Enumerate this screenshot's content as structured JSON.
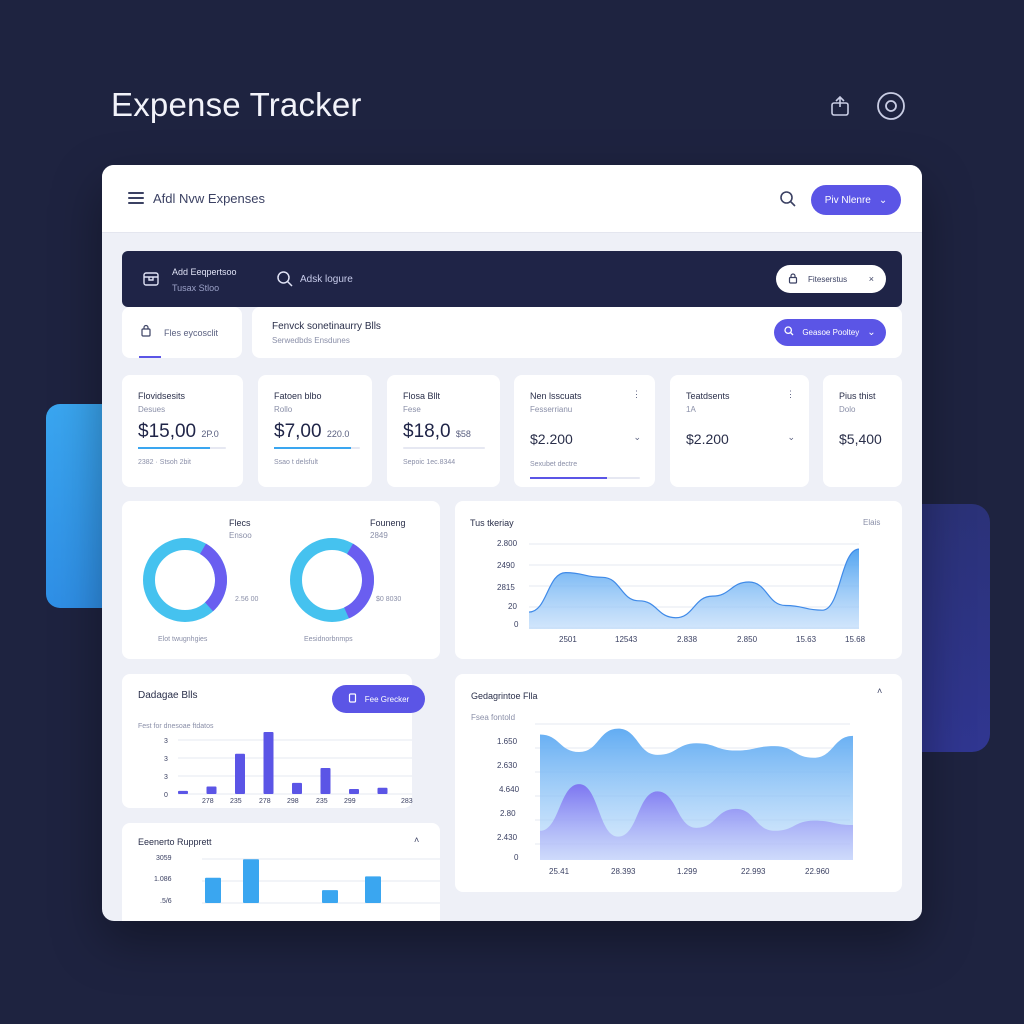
{
  "page": {
    "title": "Expense Tracker"
  },
  "top_icons": [
    "share-icon",
    "record-icon"
  ],
  "topbar": {
    "title": "Afdl Nvw Expenses",
    "action_label": "Piv Nlenre"
  },
  "darkbar": {
    "line1": "Add Eeqpertsoo",
    "line2": "Tusax Stloo",
    "search_label": "Adsk logure",
    "chip_label": "Fiteserstus",
    "chip_close": "×"
  },
  "subbar": {
    "tab_label": "Fles eycosclit",
    "title": "Fenvck sonetinaurry Blls",
    "subtitle": "Serwedbds Ensdunes",
    "action_label": "Geasoe Pooltey"
  },
  "stats": [
    {
      "title": "Flovidsesits",
      "sub": "Desues",
      "value": "$15,00",
      "value_suffix": "2P.0",
      "foot": "2382 · Stsoh 2bit",
      "progress": 0.82
    },
    {
      "title": "Fatoen blbo",
      "sub": "Rollo",
      "value": "$7,00",
      "value_suffix": "220.0",
      "foot": "Ssao t delsfult",
      "progress": 0.9
    },
    {
      "title": "Flosa Bllt",
      "sub": "Fese",
      "value": "$18,0",
      "value_suffix": "$58",
      "foot": "Sepoic 1ec.8344",
      "progress": 0
    },
    {
      "title": "Nen lsscuats",
      "sub": "Fesserrianu",
      "value": "$2.200",
      "foot": "Sexubet dectre",
      "progress": 0.7
    },
    {
      "title": "Teatdsents",
      "sub": "1A",
      "value": "$2.200",
      "progress": 0
    },
    {
      "title": "Pius thist",
      "sub": "Dolo",
      "value": "$5,400",
      "progress": 0
    }
  ],
  "donuts": [
    {
      "label": "Flecs",
      "sub": "Ensoo",
      "value_label": "2.56 00",
      "caption": "Elot twugnhgies",
      "fraction": 0.3
    },
    {
      "label": "Founeng",
      "sub": "2849",
      "value_label": "$0 8030",
      "caption": "Eesidnorbnmps",
      "fraction": 0.35
    }
  ],
  "trend_chart": {
    "title": "Tus tkeriay",
    "corner": "Elais",
    "y_ticks": [
      "2.800",
      "2490",
      "2815",
      "20",
      "0"
    ],
    "x_ticks": [
      "2501",
      "12543",
      "2.838",
      "2.850",
      "15.63",
      "15.68"
    ]
  },
  "bar_chart": {
    "title": "Dadagae Blls",
    "action_label": "Fee Grecker",
    "sub": "Fest for dnesoae ftdatos",
    "y_ticks": [
      "3",
      "3",
      "3",
      "0"
    ],
    "x_ticks": [
      "278",
      "235",
      "278",
      "298",
      "235",
      "299",
      "283"
    ]
  },
  "report_chart": {
    "title": "Eeenerto Rupprett",
    "y_ticks": [
      "3059",
      "1.086",
      ".5/6"
    ]
  },
  "area_chart": {
    "title": "Gedagrintoe Flla",
    "sub": "Fsea fontold",
    "y_ticks": [
      "1.650",
      "2.630",
      "4.640",
      "2.80",
      "2.430",
      "0"
    ],
    "x_ticks": [
      "25.41",
      "28.393",
      "1.299",
      "22.993",
      "22.960"
    ]
  },
  "chart_data": [
    {
      "type": "pie",
      "title": "",
      "series": [
        {
          "values": [
            0.7,
            0.3
          ]
        }
      ]
    },
    {
      "type": "pie",
      "title": "",
      "series": [
        {
          "values": [
            0.65,
            0.35
          ]
        }
      ]
    },
    {
      "type": "area",
      "title": "",
      "series": [
        {
          "values": [
            0.18,
            0.6,
            0.55,
            0.3,
            0.12,
            0.35,
            0.5,
            0.25,
            0.2,
            0.85
          ]
        }
      ]
    },
    {
      "type": "bar",
      "title": "",
      "series": [
        {
          "values": [
            0.05,
            0.12,
            0.65,
            1.0,
            0.18,
            0.42,
            0.08,
            0.1
          ]
        }
      ]
    },
    {
      "type": "bar",
      "title": "",
      "series": [
        {
          "values": [
            0.55,
            0.95,
            0.28,
            0.58
          ]
        }
      ]
    },
    {
      "type": "area",
      "title": "",
      "series": [
        {
          "values": [
            0.86,
            0.74,
            0.9,
            0.72,
            0.8,
            0.75,
            0.78,
            0.7,
            0.85
          ]
        },
        {
          "values": [
            0.2,
            0.52,
            0.16,
            0.47,
            0.22,
            0.35,
            0.2,
            0.27,
            0.24
          ]
        }
      ]
    }
  ]
}
